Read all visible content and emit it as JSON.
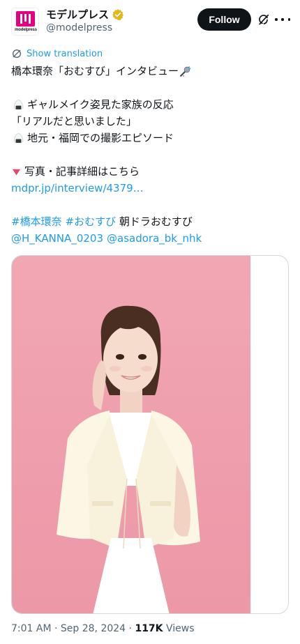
{
  "account": {
    "display_name": "モデルプレス",
    "handle": "@modelpress",
    "avatar_brand": "modelpress"
  },
  "actions": {
    "follow_label": "Follow"
  },
  "translate": {
    "label": "Show translation"
  },
  "tweet": {
    "line1": "橋本環奈「おむすび」インタビュー",
    "line2": "ギャルメイク姿見た家族の反応",
    "line3": "「リアルだと思いました」",
    "line4": "地元・福岡での撮影エピソード",
    "line5": "写真・記事詳細はこちら",
    "link": "mdpr.jp/interview/4379…",
    "hashtag1": "#橋本環奈",
    "hashtag2": "#おむすび",
    "line7_text": " 朝ドラおむすび",
    "mention1": "@H_KANNA_0203",
    "mention2": "@asadora_bk_nhk"
  },
  "meta": {
    "time": "7:01 AM",
    "date": "Sep 28, 2024",
    "views_count": "117K",
    "views_label": "Views"
  },
  "colors": {
    "accent": "#1d9bf0",
    "text": "#0f1419",
    "muted": "#536471",
    "photo_background": "#f0a4b2",
    "brand": "#e4007f"
  },
  "icons": {
    "verified": "verified-gold-badge-icon",
    "grok": "grok-icon",
    "more": "more-dots-icon",
    "translate": "translate-globe-icon",
    "microphone": "microphone-icon",
    "rice_ball": "rice-ball-icon",
    "triangle": "red-triangle-down-icon"
  }
}
